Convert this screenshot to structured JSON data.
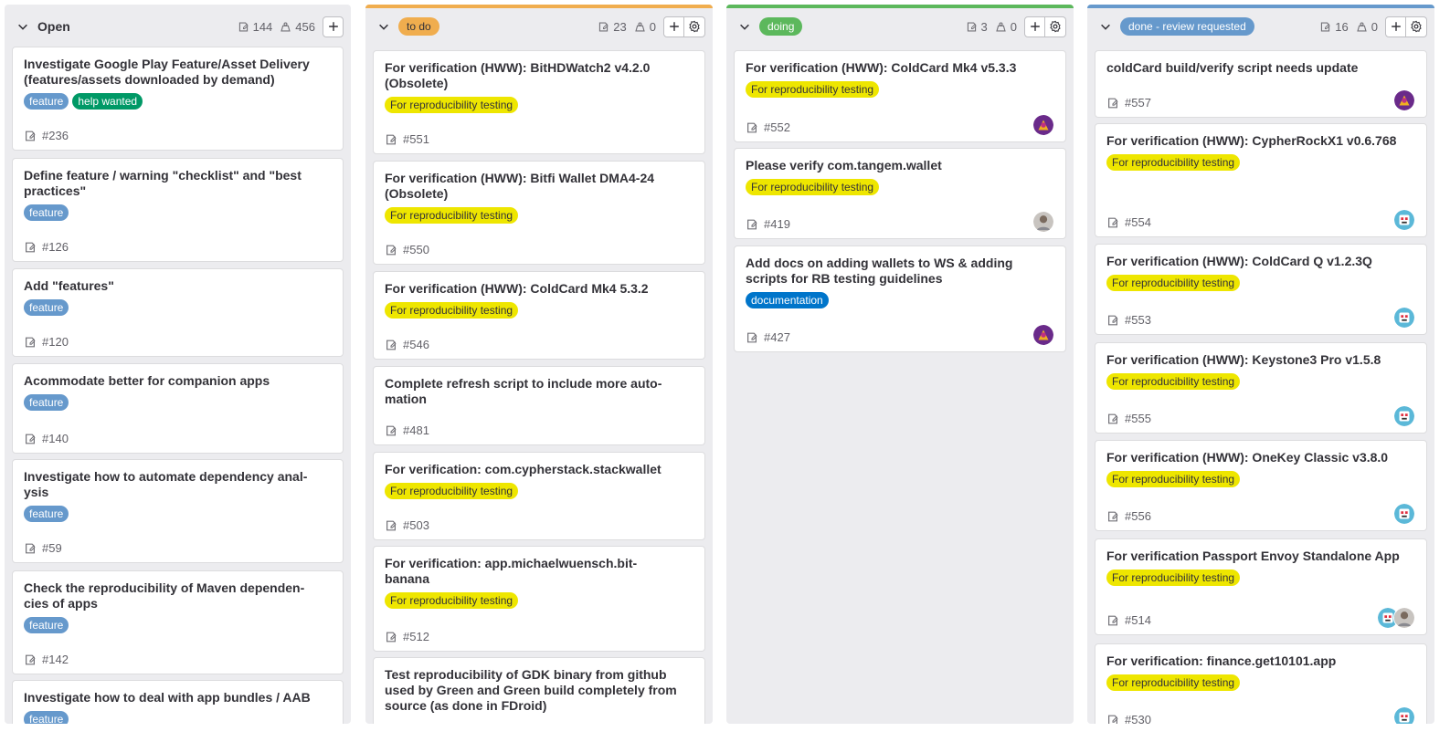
{
  "colors": {
    "feature": "#6699cc",
    "help_wanted": "#009966",
    "reproducibility": "#eee600",
    "documentation": "#0075ca",
    "todo_bar": "#f0ad4e",
    "doing_bar": "#5cb85c",
    "done_bar": "#6699cc"
  },
  "columns": [
    {
      "title": "Open",
      "issue_count": "144",
      "weight": "456",
      "cards": [
        {
          "title": "Investigate Google Play Feature/Asset Delivery (features/assets downloaded by demand)",
          "labels": [
            "feature",
            "help wanted"
          ],
          "ref": "#236"
        },
        {
          "title": "Define feature / warning \"checklist\" and \"best practices\"",
          "labels": [
            "feature"
          ],
          "ref": "#126"
        },
        {
          "title": "Add \"features\"",
          "labels": [
            "feature"
          ],
          "ref": "#120"
        },
        {
          "title": "Acommodate better for companion apps",
          "labels": [
            "feature"
          ],
          "ref": "#140"
        },
        {
          "title": "Investigate how to automate dependency anal- ysis",
          "labels": [
            "feature"
          ],
          "ref": "#59"
        },
        {
          "title": "Check the reproducibility of Maven dependen- cies of apps",
          "labels": [
            "feature"
          ],
          "ref": "#142"
        },
        {
          "title": "Investigate how to deal with app bundles / AAB",
          "labels": [
            "feature"
          ],
          "ref": ""
        }
      ]
    },
    {
      "title": "to do",
      "issue_count": "23",
      "weight": "0",
      "cards": [
        {
          "title": "For verification (HWW): BitHDWatch2 v4.2.0 (Obsolete)",
          "labels": [
            "For reproducibility testing"
          ],
          "ref": "#551"
        },
        {
          "title": "For verification (HWW): Bitfi Wallet DMA4-24 (Obsolete)",
          "labels": [
            "For reproducibility testing"
          ],
          "ref": "#550"
        },
        {
          "title": "For verification (HWW): ColdCard Mk4 5.3.2",
          "labels": [
            "For reproducibility testing"
          ],
          "ref": "#546"
        },
        {
          "title": "Complete refresh script to include more auto- mation",
          "labels": [],
          "ref": "#481"
        },
        {
          "title": "For verification: com.cypherstack.stackwallet",
          "labels": [
            "For reproducibility testing"
          ],
          "ref": "#503"
        },
        {
          "title": "For verification: app.michaelwuensch.bit- banana",
          "labels": [
            "For reproducibility testing"
          ],
          "ref": "#512"
        },
        {
          "title": "Test reproducibility of GDK binary from github used by Green and Green build completely from source (as done in FDroid)",
          "labels": [],
          "ref": ""
        }
      ]
    },
    {
      "title": "doing",
      "issue_count": "3",
      "weight": "0",
      "cards": [
        {
          "title": "For verification (HWW): ColdCard Mk4 v5.3.3",
          "labels": [
            "For reproducibility testing"
          ],
          "ref": "#552"
        },
        {
          "title": "Please verify com.tangem.wallet",
          "labels": [
            "For reproducibility testing"
          ],
          "ref": "#419"
        },
        {
          "title": "Add docs on adding wallets to WS & adding scripts for RB testing guidelines",
          "labels": [
            "documentation"
          ],
          "ref": "#427"
        }
      ]
    },
    {
      "title": "done - review requested",
      "issue_count": "16",
      "weight": "0",
      "cards": [
        {
          "title": "coldCard build/verify script needs update",
          "labels": [],
          "ref": "#557"
        },
        {
          "title": "For verification (HWW): CypherRockX1 v0.6.768",
          "labels": [
            "For reproducibility testing"
          ],
          "ref": "#554"
        },
        {
          "title": "For verification (HWW): ColdCard Q v1.2.3Q",
          "labels": [
            "For reproducibility testing"
          ],
          "ref": "#553"
        },
        {
          "title": "For verification (HWW): Keystone3 Pro v1.5.8",
          "labels": [
            "For reproducibility testing"
          ],
          "ref": "#555"
        },
        {
          "title": "For verification (HWW): OneKey Classic v3.8.0",
          "labels": [
            "For reproducibility testing"
          ],
          "ref": "#556"
        },
        {
          "title": "For verification Passport Envoy Standalone App",
          "labels": [
            "For reproducibility testing"
          ],
          "ref": "#514"
        },
        {
          "title": "For verification: finance.get10101.app",
          "labels": [
            "For reproducibility testing"
          ],
          "ref": "#530"
        }
      ]
    }
  ]
}
